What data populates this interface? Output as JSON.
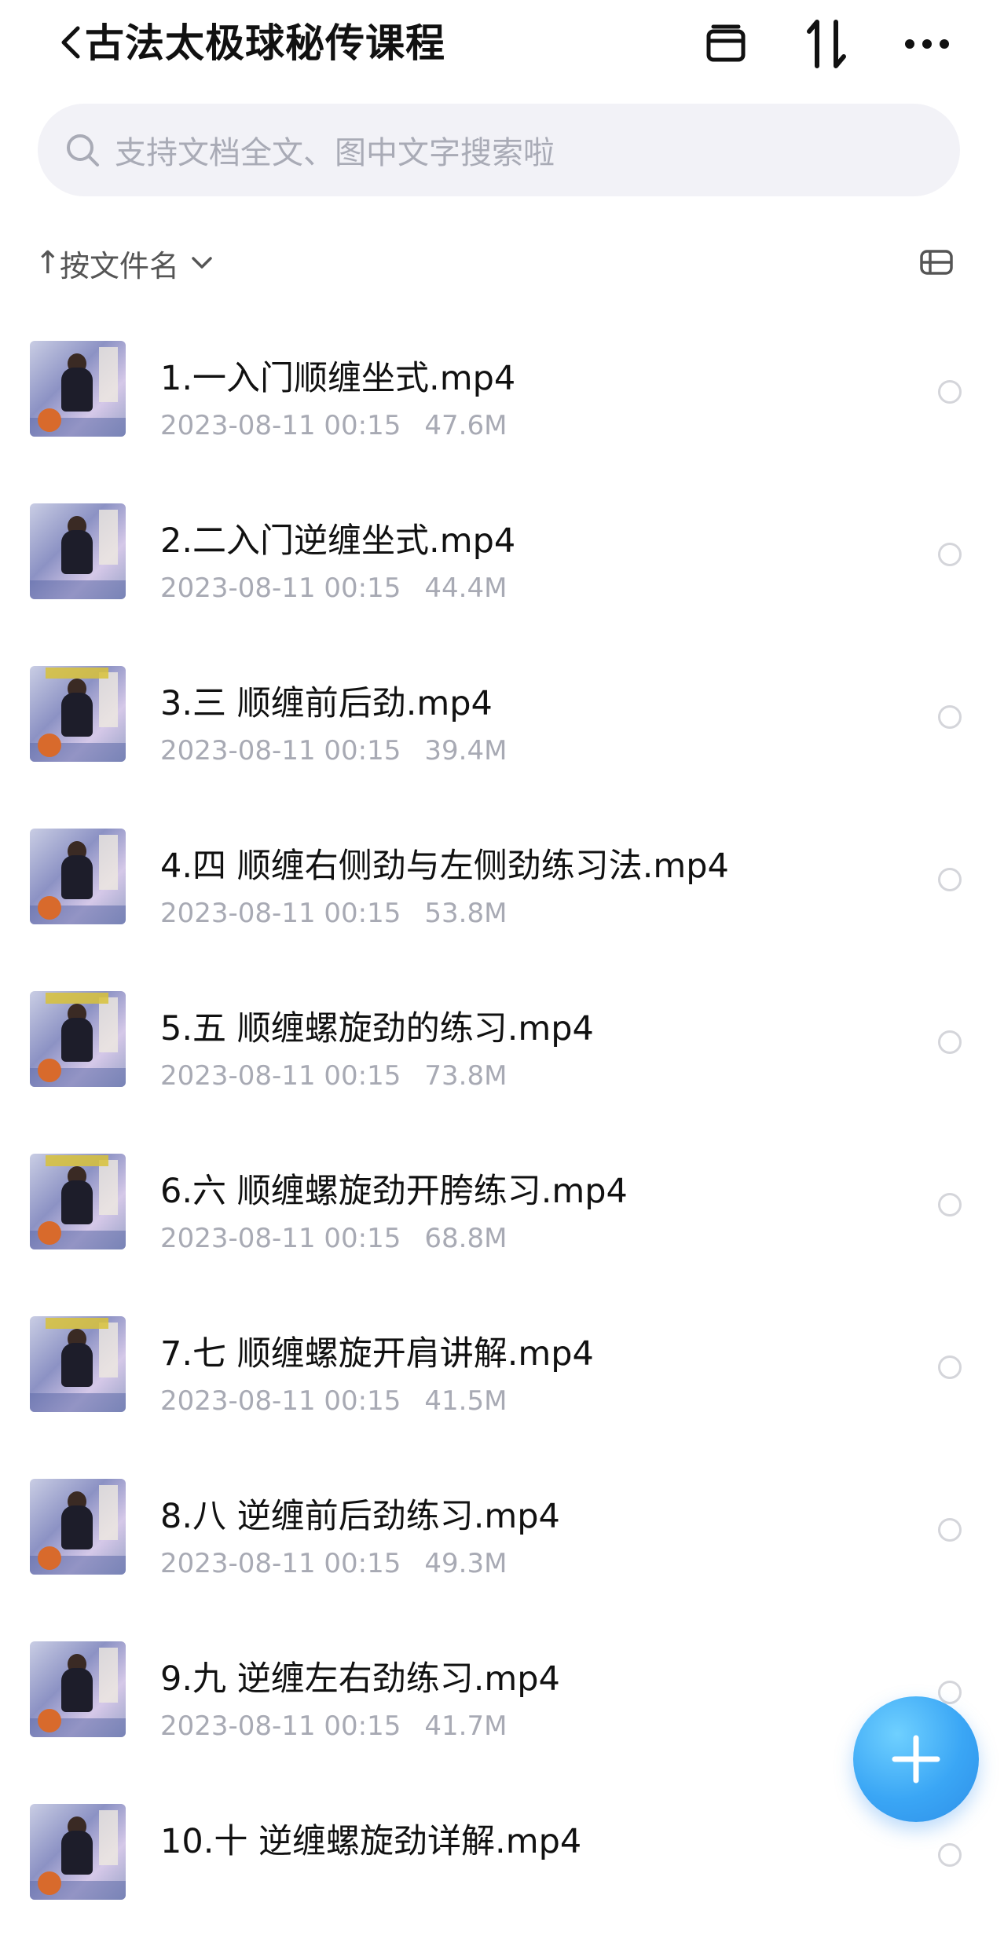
{
  "header": {
    "title": "古法太极球秘传课程",
    "icons": [
      "back-icon",
      "archive-icon",
      "sort-icon",
      "more-icon"
    ]
  },
  "search": {
    "placeholder": "支持文档全文、图中文字搜索啦"
  },
  "sort": {
    "arrow": "↑",
    "label": "按文件名"
  },
  "files": [
    {
      "name": "1.一入门顺缠坐式.mp4",
      "date": "2023-08-11 00:15",
      "size": "47.6M"
    },
    {
      "name": "2.二入门逆缠坐式.mp4",
      "date": "2023-08-11 00:15",
      "size": "44.4M"
    },
    {
      "name": "3.三 顺缠前后劲.mp4",
      "date": "2023-08-11 00:15",
      "size": "39.4M"
    },
    {
      "name": "4.四  顺缠右侧劲与左侧劲练习法.mp4",
      "date": "2023-08-11 00:15",
      "size": "53.8M"
    },
    {
      "name": "5.五 顺缠螺旋劲的练习.mp4",
      "date": "2023-08-11 00:15",
      "size": "73.8M"
    },
    {
      "name": "6.六 顺缠螺旋劲开胯练习.mp4",
      "date": "2023-08-11 00:15",
      "size": "68.8M"
    },
    {
      "name": "7.七 顺缠螺旋开肩讲解.mp4",
      "date": "2023-08-11 00:15",
      "size": "41.5M"
    },
    {
      "name": "8.八 逆缠前后劲练习.mp4",
      "date": "2023-08-11 00:15",
      "size": "49.3M"
    },
    {
      "name": "9.九 逆缠左右劲练习.mp4",
      "date": "2023-08-11 00:15",
      "size": "41.7M"
    },
    {
      "name": "10.十 逆缠螺旋劲详解.mp4",
      "date": "",
      "size": ""
    }
  ],
  "colors": {
    "accent": "#3aa6f5",
    "meta_text": "#a8aab4",
    "search_bg": "#f2f2f7"
  }
}
